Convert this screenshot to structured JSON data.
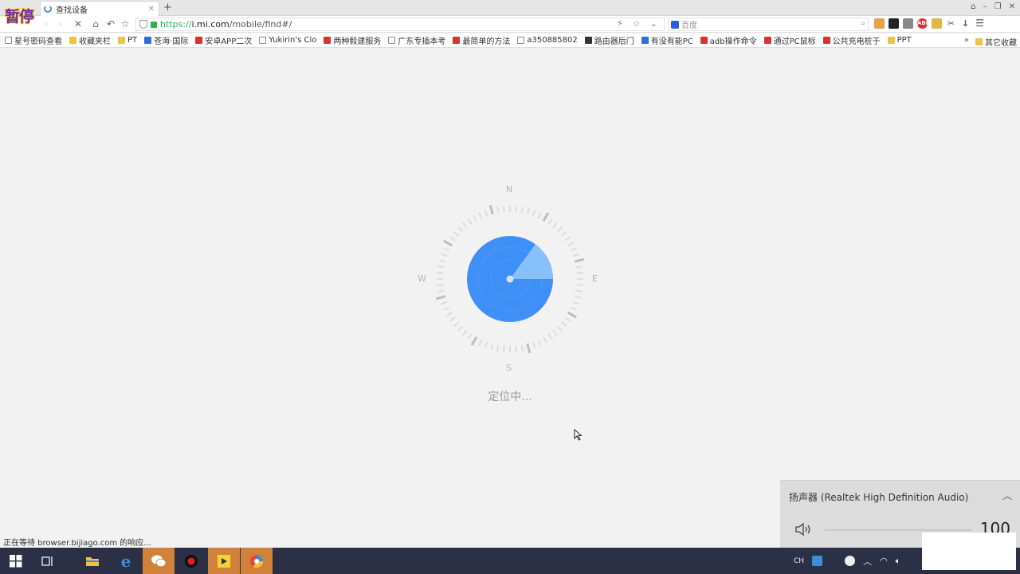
{
  "browser": {
    "watermark": "暂停",
    "tab_title": "查找设备",
    "new_tab": "+",
    "address": {
      "protocol": "https://",
      "host": "i.mi.com",
      "path": "/mobile/find#/"
    },
    "search_placeholder": "百度",
    "bookmarks": [
      {
        "label": "星号密码查看",
        "icon": "page"
      },
      {
        "label": "收藏夹栏",
        "icon": "folder"
      },
      {
        "label": "PT",
        "icon": "folder"
      },
      {
        "label": "苍海·国际",
        "icon": "blue"
      },
      {
        "label": "安卓APP二次",
        "icon": "red"
      },
      {
        "label": "Yukirin's Clo",
        "icon": "page"
      },
      {
        "label": "两种毅建服务",
        "icon": "red"
      },
      {
        "label": "广东专插本考",
        "icon": "page"
      },
      {
        "label": "最简单的方法",
        "icon": "red"
      },
      {
        "label": "a350885802",
        "icon": "page"
      },
      {
        "label": "路由器后门",
        "icon": "dark"
      },
      {
        "label": "有没有能PC",
        "icon": "blue"
      },
      {
        "label": "adb操作命令",
        "icon": "red"
      },
      {
        "label": "通过PC鼠标",
        "icon": "red"
      },
      {
        "label": "公共充电桩于",
        "icon": "red"
      },
      {
        "label": "PPT",
        "icon": "folder"
      }
    ],
    "bookmarks_more": "»",
    "other_bookmarks": "其它收藏"
  },
  "page": {
    "compass": {
      "north": "N",
      "east": "E",
      "south": "S",
      "west": "W"
    },
    "status_text": "定位中..."
  },
  "status_bar": "正在等待 browser.bijiago.com 的响应...",
  "volume": {
    "device": "扬声器 (Realtek High Definition Audio)",
    "level": "100",
    "level_fraction": 1.0
  },
  "tray": {
    "ime": "CH"
  },
  "colors": {
    "radar_blue": "#3f8ff6",
    "radar_sweep": "#8fc5fb",
    "taskbar": "#2c3046",
    "taskbar_active": "#d2813a"
  }
}
